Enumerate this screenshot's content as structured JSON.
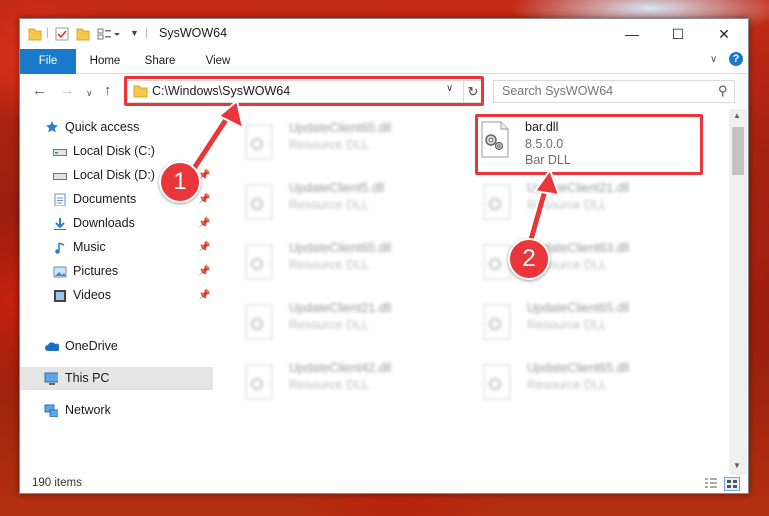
{
  "window": {
    "title": "SysWOW64",
    "minimize_glyph": "—",
    "maximize_glyph": "☐",
    "close_glyph": "✕"
  },
  "ribbon": {
    "tabs": [
      {
        "label": "File"
      },
      {
        "label": "Home"
      },
      {
        "label": "Share"
      },
      {
        "label": "View"
      }
    ],
    "help_glyph": "?"
  },
  "address": {
    "path": "C:\\Windows\\SysWOW64",
    "search_placeholder": "Search SysWOW64"
  },
  "sidebar": {
    "items": [
      {
        "label": "Quick access",
        "icon": "star-icon"
      },
      {
        "label": "Local Disk (C:)",
        "icon": "drive-icon"
      },
      {
        "label": "Local Disk (D:)",
        "icon": "drive-icon"
      },
      {
        "label": "Documents",
        "icon": "documents-icon"
      },
      {
        "label": "Downloads",
        "icon": "download-icon"
      },
      {
        "label": "Music",
        "icon": "music-icon"
      },
      {
        "label": "Pictures",
        "icon": "pictures-icon"
      },
      {
        "label": "Videos",
        "icon": "videos-icon"
      },
      {
        "label": "OneDrive",
        "icon": "cloud-icon"
      },
      {
        "label": "This PC",
        "icon": "computer-icon"
      },
      {
        "label": "Network",
        "icon": "network-icon"
      }
    ]
  },
  "files": [
    {
      "name": "UpdateClient65.dll",
      "type": "Resource DLL"
    },
    {
      "name": "bar.dll",
      "version": "8.5.0.0",
      "description": "Bar DLL"
    },
    {
      "name": "UpdateClient5.dll",
      "type": "Resource DLL"
    },
    {
      "name": "UpdateClient21.dll",
      "type": "Resource DLL"
    },
    {
      "name": "UpdateClient65.dll",
      "type": "Resource DLL"
    },
    {
      "name": "UpdateClient63.dll",
      "type": "Resource DLL"
    },
    {
      "name": "UpdateClient21.dll",
      "type": "Resource DLL"
    },
    {
      "name": "UpdateClient65.dll",
      "type": "Resource DLL"
    },
    {
      "name": "UpdateClient42.dll",
      "type": "Resource DLL"
    },
    {
      "name": "UpdateClient65.dll",
      "type": "Resource DLL"
    }
  ],
  "status": {
    "item_count": "190 items"
  },
  "annotations": {
    "badge_1": "1",
    "badge_2": "2",
    "highlight_color": "#e8363a"
  }
}
